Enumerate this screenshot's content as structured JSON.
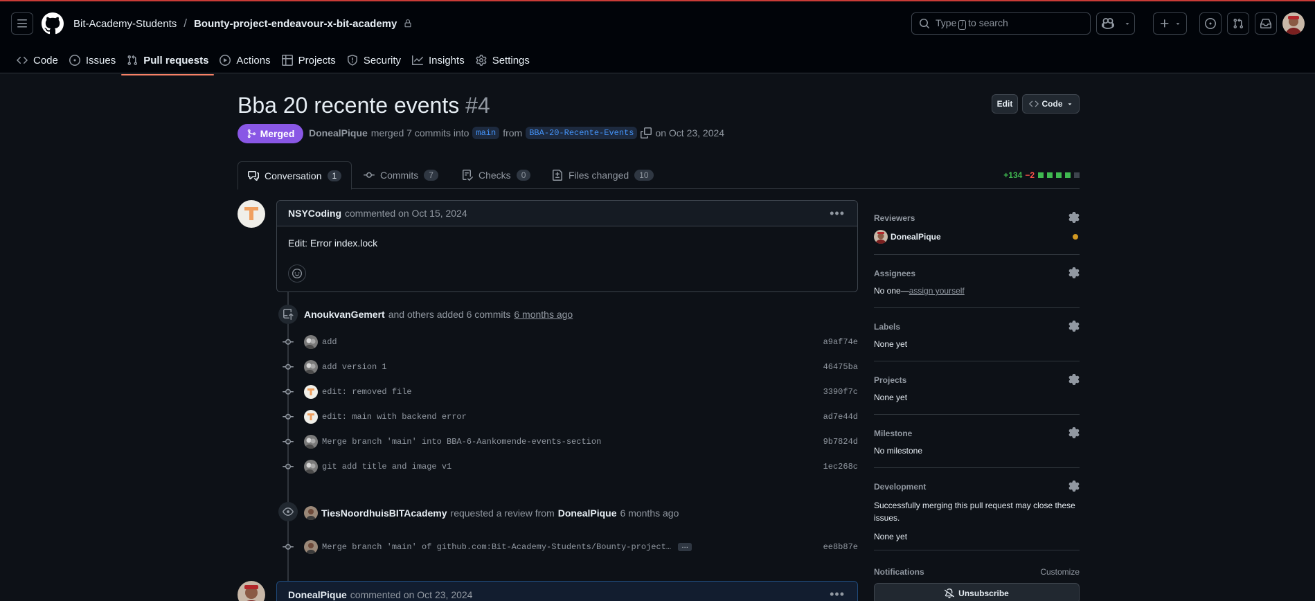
{
  "header": {
    "owner": "Bit-Academy-Students",
    "separator": "/",
    "repo": "Bounty-project-endeavour-x-bit-academy",
    "search_prefix": "Type",
    "search_key": "/",
    "search_suffix": "to search"
  },
  "nav": [
    {
      "label": "Code",
      "icon": "code-icon"
    },
    {
      "label": "Issues",
      "icon": "issue-icon"
    },
    {
      "label": "Pull requests",
      "icon": "pull-request-icon",
      "active": true
    },
    {
      "label": "Actions",
      "icon": "play-icon"
    },
    {
      "label": "Projects",
      "icon": "table-icon"
    },
    {
      "label": "Security",
      "icon": "shield-icon"
    },
    {
      "label": "Insights",
      "icon": "graph-icon"
    },
    {
      "label": "Settings",
      "icon": "gear-icon"
    }
  ],
  "pr": {
    "title": "Bba 20 recente events",
    "number": "#4",
    "edit_label": "Edit",
    "code_label": "Code",
    "status": "Merged",
    "author": "DonealPique",
    "merged_text": "merged 7 commits into",
    "base_branch": "main",
    "from_text": "from",
    "head_branch": "BBA-20-Recente-Events",
    "date_text": "on Oct 23, 2024"
  },
  "tabs": [
    {
      "label": "Conversation",
      "count": "1",
      "active": true
    },
    {
      "label": "Commits",
      "count": "7"
    },
    {
      "label": "Checks",
      "count": "0"
    },
    {
      "label": "Files changed",
      "count": "10"
    }
  ],
  "diffstat": {
    "additions": "+134",
    "deletions": "−2",
    "blocks": [
      "green",
      "green",
      "green",
      "green",
      "gray"
    ]
  },
  "colors": {
    "merged": "#8957e5",
    "accent": "#f78166",
    "link": "#4493f8",
    "add": "#3fb950",
    "del": "#f85149"
  },
  "first_comment": {
    "author": "NSYCoding",
    "meta": "commented on Oct 15, 2024",
    "body": "Edit: Error index.lock"
  },
  "commit_event": {
    "author": "AnoukvanGemert",
    "text": "and others added 6 commits",
    "time": "6 months ago"
  },
  "commits": [
    {
      "message": "add",
      "sha": "a9af74e",
      "avatar": "gray"
    },
    {
      "message": "add version 1",
      "sha": "46475ba",
      "avatar": "gray"
    },
    {
      "message": "edit: removed file",
      "sha": "3390f7c",
      "avatar": "orange"
    },
    {
      "message": "edit: main with backend error",
      "sha": "ad7e44d",
      "avatar": "orange"
    },
    {
      "message": "Merge branch 'main' into BBA-6-Aankomende-events-section",
      "sha": "9b7824d",
      "avatar": "gray"
    },
    {
      "message": "git add title and image v1",
      "sha": "1ec268c",
      "avatar": "gray"
    }
  ],
  "review_event": {
    "author": "TiesNoordhuisBITAcademy",
    "text": "requested a review from",
    "reviewer": "DonealPique",
    "time": "6 months ago"
  },
  "last_commit": {
    "message": "Merge branch 'main' of github.com:Bit-Academy-Students/Bounty-project…",
    "more": "…",
    "sha": "ee8b87e"
  },
  "second_comment": {
    "author": "DonealPique",
    "meta": "commented on Oct 23, 2024"
  },
  "sidebar": {
    "reviewers_title": "Reviewers",
    "reviewer_name": "DonealPique",
    "assignees_title": "Assignees",
    "assignees_none": "No one—",
    "assign_yourself": "assign yourself",
    "labels_title": "Labels",
    "labels_value": "None yet",
    "projects_title": "Projects",
    "projects_value": "None yet",
    "milestone_title": "Milestone",
    "milestone_value": "No milestone",
    "development_title": "Development",
    "development_text": "Successfully merging this pull request may close these issues.",
    "development_value": "None yet",
    "notifications_title": "Notifications",
    "customize": "Customize",
    "unsubscribe": "Unsubscribe"
  }
}
